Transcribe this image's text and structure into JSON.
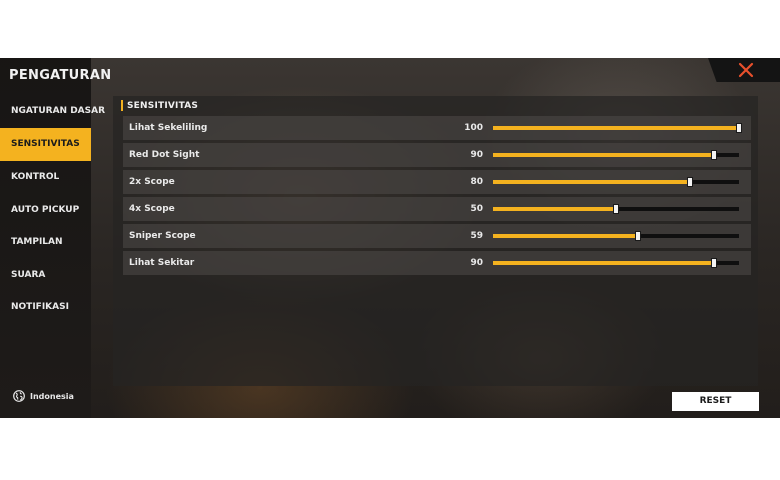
{
  "sidebar": {
    "title": "PENGATURAN",
    "items": [
      {
        "label": "NGATURAN DASAR",
        "active": false
      },
      {
        "label": "SENSITIVITAS",
        "active": true
      },
      {
        "label": "KONTROL",
        "active": false
      },
      {
        "label": "AUTO PICKUP",
        "active": false
      },
      {
        "label": "TAMPILAN",
        "active": false
      },
      {
        "label": "SUARA",
        "active": false
      },
      {
        "label": "NOTIFIKASI",
        "active": false
      }
    ],
    "language": {
      "icon": "globe-icon",
      "label": "Indonesia"
    }
  },
  "close": {
    "icon": "close-icon",
    "color": "#e8502c"
  },
  "section": {
    "title": "SENSITIVITAS"
  },
  "settings": [
    {
      "label": "Lihat Sekeliling",
      "value": "100",
      "level": 100
    },
    {
      "label": "Red Dot Sight",
      "value": "90",
      "level": 90
    },
    {
      "label": "2x Scope",
      "value": "80",
      "level": 80
    },
    {
      "label": "4x Scope",
      "value": "50",
      "level": 50
    },
    {
      "label": "Sniper Scope",
      "value": "59",
      "level": 59
    },
    {
      "label": "Lihat Sekitar",
      "value": "90",
      "level": 90
    }
  ],
  "actions": {
    "reset_label": "RESET"
  },
  "colors": {
    "accent": "#f4b21f",
    "close": "#e8502c"
  }
}
